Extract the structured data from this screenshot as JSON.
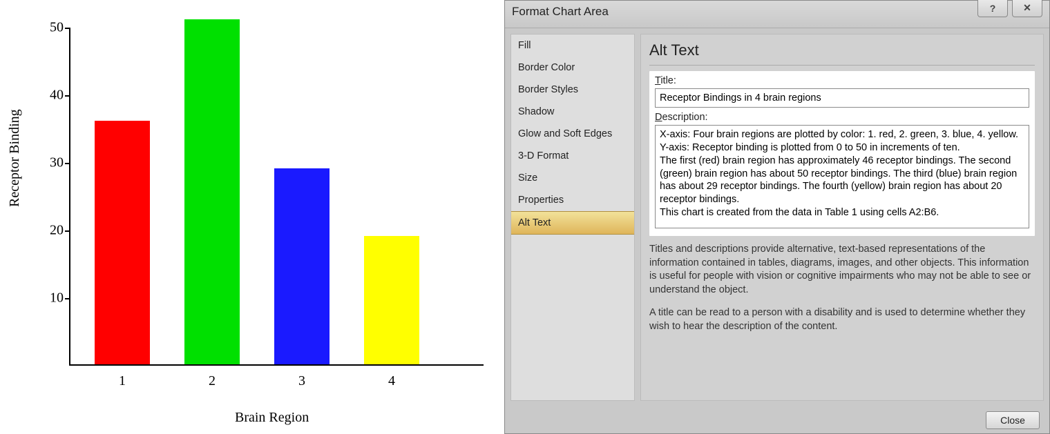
{
  "chart_data": {
    "type": "bar",
    "categories": [
      "1",
      "2",
      "3",
      "4"
    ],
    "values": [
      36,
      51,
      29,
      19
    ],
    "colors": [
      "#ff0000",
      "#00e000",
      "#1a1aff",
      "#ffff00"
    ],
    "title": "",
    "xlabel": "Brain Region",
    "ylabel": "Receptor Binding",
    "ylim": [
      0,
      50
    ],
    "yticks": [
      10,
      20,
      30,
      40,
      50
    ]
  },
  "dialog": {
    "window_title": "Format Chart Area",
    "help_glyph": "?",
    "close_glyph": "✕",
    "sidebar": {
      "items": [
        "Fill",
        "Border Color",
        "Border Styles",
        "Shadow",
        "Glow and Soft Edges",
        "3-D Format",
        "Size",
        "Properties",
        "Alt Text"
      ],
      "selected_index": 8
    },
    "panel": {
      "heading": "Alt Text",
      "title_label_pre": "T",
      "title_label_rest": "itle:",
      "title_value": "Receptor Bindings in 4 brain regions",
      "desc_label_pre": "D",
      "desc_label_rest": "escription:",
      "desc_value": "X-axis: Four brain regions are plotted by color: 1. red, 2. green, 3. blue, 4. yellow. Y-axis: Receptor binding is plotted from 0 to 50 in increments of ten.\nThe first (red) brain region has approximately 46 receptor bindings. The second (green) brain region has about 50 receptor bindings. The third (blue) brain region has about 29 receptor bindings. The fourth (yellow) brain region has about 20 receptor bindings.\nThis chart is created from the data in Table 1 using cells A2:B6.",
      "info1": "Titles and descriptions provide alternative, text-based representations of the information contained in tables, diagrams, images, and other objects. This information is useful for people with vision or cognitive impairments who may not be able to see or understand the object.",
      "info2": "A title can be read to a person with a disability and is used to determine whether they wish to hear the description of the content."
    },
    "close_button": "Close"
  }
}
